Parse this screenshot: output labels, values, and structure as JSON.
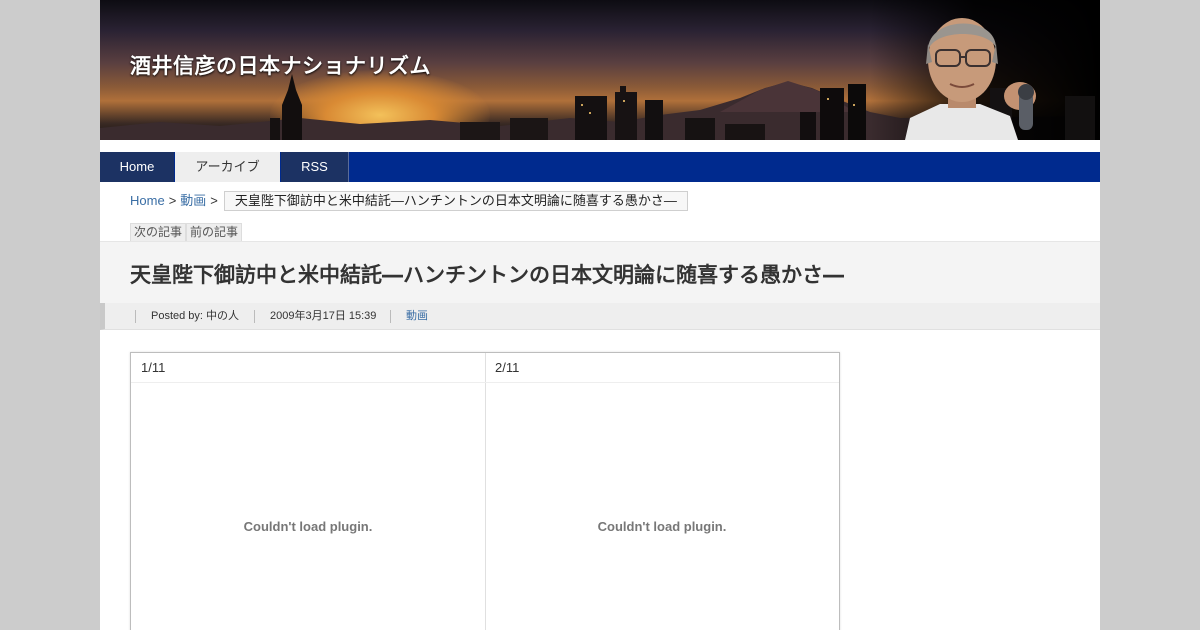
{
  "site": {
    "title": "酒井信彦の日本ナショナリズム"
  },
  "nav": {
    "items": [
      {
        "label": "Home"
      },
      {
        "label": "アーカイブ"
      },
      {
        "label": "RSS"
      }
    ]
  },
  "breadcrumb": {
    "home": "Home",
    "separator": ">",
    "category": "動画",
    "current": "天皇陛下御訪中と米中結託―ハンチントンの日本文明論に随喜する愚かさ―"
  },
  "pager": {
    "next": "次の記事",
    "prev": "前の記事"
  },
  "entry": {
    "title": "天皇陛下御訪中と米中結託―ハンチントンの日本文明論に随喜する愚かさ―",
    "posted_by": "Posted by: 中の人",
    "date": "2009年3月17日 15:39",
    "category": "動画"
  },
  "videos": [
    {
      "label": "1/11",
      "status": "Couldn't load plugin."
    },
    {
      "label": "2/11",
      "status": "Couldn't load plugin."
    }
  ],
  "colors": {
    "nav_bar": "#002a8e",
    "nav_tab": "#1c3263",
    "link": "#3a6ea5",
    "page_bg": "#cccccc"
  }
}
